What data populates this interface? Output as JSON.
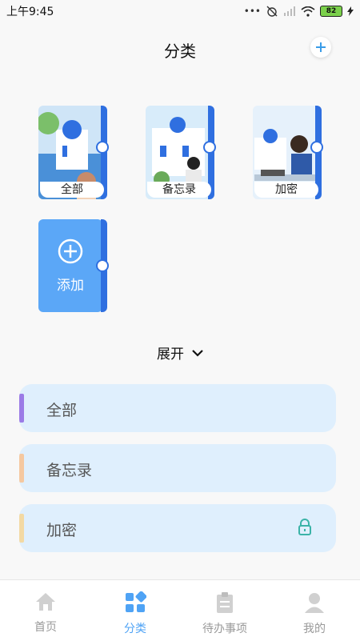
{
  "status": {
    "time": "上午9:45",
    "battery": "82"
  },
  "header": {
    "title": "分类"
  },
  "categories": [
    {
      "label": "全部"
    },
    {
      "label": "备忘录"
    },
    {
      "label": "加密"
    }
  ],
  "add_tile": {
    "label": "添加"
  },
  "expand": {
    "label": "展开"
  },
  "list": [
    {
      "label": "全部",
      "color": "#9b7be6",
      "locked": false
    },
    {
      "label": "备忘录",
      "color": "#f5c8a0",
      "locked": false
    },
    {
      "label": "加密",
      "color": "#f3d9a3",
      "locked": true
    }
  ],
  "tabs": [
    {
      "label": "首页",
      "icon": "home-icon",
      "active": false
    },
    {
      "label": "分类",
      "icon": "category-icon",
      "active": true
    },
    {
      "label": "待办事项",
      "icon": "todo-icon",
      "active": false
    },
    {
      "label": "我的",
      "icon": "profile-icon",
      "active": false
    }
  ],
  "colors": {
    "accent": "#4fa3f5",
    "tile": "#5ba7f7",
    "spine": "#2f6fe0",
    "list_bg": "#dfeffd"
  }
}
